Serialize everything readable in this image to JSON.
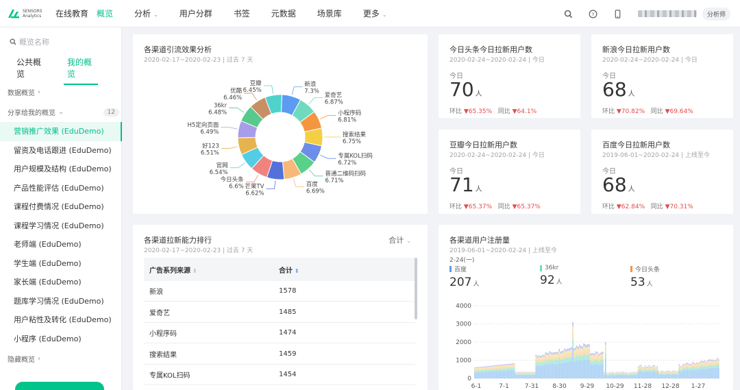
{
  "topbar": {
    "logo_text_1": "SENSORS",
    "logo_text_2": "Analytics",
    "brand": "在线教育",
    "nav": [
      {
        "label": "概览",
        "active": true,
        "caret": false
      },
      {
        "label": "分析",
        "active": false,
        "caret": true
      },
      {
        "label": "用户分群",
        "active": false,
        "caret": false
      },
      {
        "label": "书签",
        "active": false,
        "caret": false
      },
      {
        "label": "元数据",
        "active": false,
        "caret": false
      },
      {
        "label": "场景库",
        "active": false,
        "caret": false
      },
      {
        "label": "更多",
        "active": false,
        "caret": true
      }
    ],
    "role": "分析师"
  },
  "sidebar": {
    "search_placeholder": "概览名称",
    "tabs": [
      "公共概览",
      "我的概览"
    ],
    "section_data": "数据概览",
    "section_shared": "分享给我的概览",
    "shared_count": "12",
    "items": [
      "营销推广效果 (EduDemo)",
      "留资及电话跟进 (EduDemo)",
      "用户规模及结构 (EduDemo)",
      "产品性能评估 (EduDemo)",
      "课程付费情况 (EduDemo)",
      "课程学习情况 (EduDemo)",
      "老师端 (EduDemo)",
      "学生端 (EduDemo)",
      "家长端 (EduDemo)",
      "题库学习情况 (EduDemo)",
      "用户粘性及转化 (EduDemo)",
      "小程序 (EduDemo)"
    ],
    "section_hidden": "隐藏概览"
  },
  "donut_card": {
    "title": "各渠道引流效果分析",
    "sub": "2020-02-17~2020-02-23 | 过去 7 天"
  },
  "chart_data": {
    "type": "pie",
    "series": [
      {
        "name": "新浪",
        "value": 7.3,
        "label": "7.3%",
        "color": "#5b9bf0"
      },
      {
        "name": "爱奇艺",
        "value": 6.87,
        "label": "6.87%",
        "color": "#6fdac0"
      },
      {
        "name": "小程序码",
        "value": 6.81,
        "label": "6.81%",
        "color": "#f4963e"
      },
      {
        "name": "搜索结果",
        "value": 6.75,
        "label": "6.75%",
        "color": "#f5cf43"
      },
      {
        "name": "专属KOL扫码",
        "value": 6.72,
        "label": "6.72%",
        "color": "#6d8de8"
      },
      {
        "name": "普通二维码扫码",
        "value": 6.71,
        "label": "6.71%",
        "color": "#5ad08a"
      },
      {
        "name": "百度",
        "value": 6.69,
        "label": "6.69%",
        "color": "#f7b978"
      },
      {
        "name": "芒果TV",
        "value": 6.62,
        "label": "6.62%",
        "color": "#5470d9"
      },
      {
        "name": "今日头条",
        "value": 6.6,
        "label": "6.6%",
        "color": "#f0837e"
      },
      {
        "name": "官网",
        "value": 6.54,
        "label": "6.54%",
        "color": "#52cde4"
      },
      {
        "name": "好123",
        "value": 6.51,
        "label": "6.51%",
        "color": "#e7b34f"
      },
      {
        "name": "H5定向页面",
        "value": 6.49,
        "label": "6.49%",
        "color": "#a89de8"
      },
      {
        "name": "36kr",
        "value": 6.48,
        "label": "6.48%",
        "color": "#58c98c"
      },
      {
        "name": "优酷",
        "value": 6.46,
        "label": "6.46%",
        "color": "#c78f64"
      },
      {
        "name": "豆瓣",
        "value": 6.45,
        "label": "6.45%",
        "color": "#4fd1cc"
      }
    ]
  },
  "kpis": [
    {
      "title": "今日头条今日拉新用户数",
      "sub": "2020-02-24~2020-02-24 | 今日",
      "label": "今日",
      "value": "70",
      "unit": "人",
      "hb_label": "环比",
      "hb": "▼65.35%",
      "tb_label": "同比",
      "tb": "▼64.1%"
    },
    {
      "title": "新浪今日拉新用户数",
      "sub": "2020-02-24~2020-02-24 | 今日",
      "label": "今日",
      "value": "68",
      "unit": "人",
      "hb_label": "环比",
      "hb": "▼70.82%",
      "tb_label": "同比",
      "tb": "▼69.64%"
    },
    {
      "title": "豆瓣今日拉新用户数",
      "sub": "2020-02-24~2020-02-24 | 今日",
      "label": "今日",
      "value": "71",
      "unit": "人",
      "hb_label": "环比",
      "hb": "▼65.37%",
      "tb_label": "同比",
      "tb": "▼65.37%"
    },
    {
      "title": "百度今日拉新用户数",
      "sub": "2019-06-01~2020-02-24 | 上线至今",
      "label": "今日",
      "value": "68",
      "unit": "人",
      "hb_label": "环比",
      "hb": "▼62.84%",
      "tb_label": "同比",
      "tb": "▼70.31%"
    }
  ],
  "table_card": {
    "title": "各渠道拉新能力排行",
    "sub": "2020-02-17~2020-02-23 | 过去 7 天",
    "select": "合计",
    "headers": [
      "广告系列来源",
      "合计"
    ],
    "rows": [
      {
        "source": "新浪",
        "total": "1578"
      },
      {
        "source": "爱奇艺",
        "total": "1485"
      },
      {
        "source": "小程序码",
        "total": "1474"
      },
      {
        "source": "搜索结果",
        "total": "1459"
      },
      {
        "source": "专属KOL扫码",
        "total": "1454"
      }
    ]
  },
  "reg_card": {
    "title": "各渠道用户注册量",
    "sub": "2019-06-01~2020-02-24 | 上线至今",
    "date": "2-24(一)",
    "stats": [
      {
        "name": "百度",
        "value": "207",
        "unit": "人",
        "color": "#5b9bf0"
      },
      {
        "name": "36kr",
        "value": "92",
        "unit": "人",
        "color": "#6fdac0"
      },
      {
        "name": "今日头条",
        "value": "53",
        "unit": "人",
        "color": "#f4963e"
      }
    ],
    "y_ticks": [
      "4000",
      "3000",
      "2000",
      "1000",
      "0"
    ],
    "x_ticks": [
      "6-1",
      "7-1",
      "7-31",
      "8-30",
      "9-29",
      "10-29",
      "11-28",
      "12-28",
      "1-27"
    ]
  }
}
